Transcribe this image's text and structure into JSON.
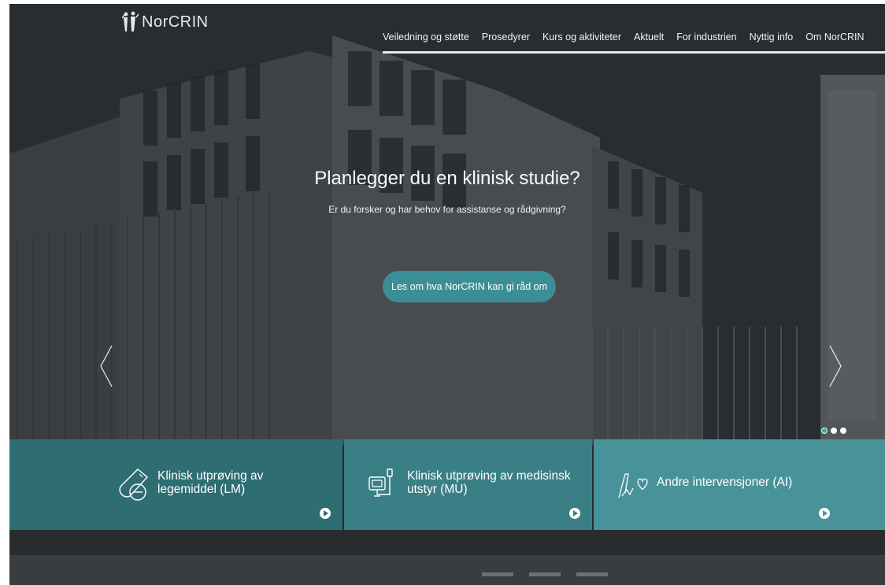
{
  "brand": {
    "name": "NorCRIN",
    "logo_icon": "people-icon"
  },
  "nav": {
    "items": [
      {
        "label": "Veiledning og støtte"
      },
      {
        "label": "Prosedyrer"
      },
      {
        "label": "Kurs og aktiviteter"
      },
      {
        "label": "Aktuelt"
      },
      {
        "label": "For industrien"
      },
      {
        "label": "Nyttig info"
      },
      {
        "label": "Om NorCRIN"
      }
    ]
  },
  "hero": {
    "title": "Planlegger du en klinisk studie?",
    "subtitle": "Er du forsker og har behov for assistanse og rådgivning?",
    "cta_label": "Les om hva NorCRIN kan gi råd om",
    "prev_icon": "chevron-left-icon",
    "next_icon": "chevron-right-icon",
    "slides_count": 3,
    "active_slide": 1
  },
  "cards": [
    {
      "label": "Klinisk utprøving av legemiddel (LM)",
      "icon": "pill-icon"
    },
    {
      "label": "Klinisk utprøving av medisinsk utstyr (MU)",
      "icon": "medical-device-icon"
    },
    {
      "label": "Andre intervensjoner (AI)",
      "icon": "hand-heart-icon"
    }
  ],
  "colors": {
    "accent": "#3b8e96",
    "card_1": "#2e6e73",
    "card_2": "#3a7f86",
    "card_3": "#48939a"
  }
}
